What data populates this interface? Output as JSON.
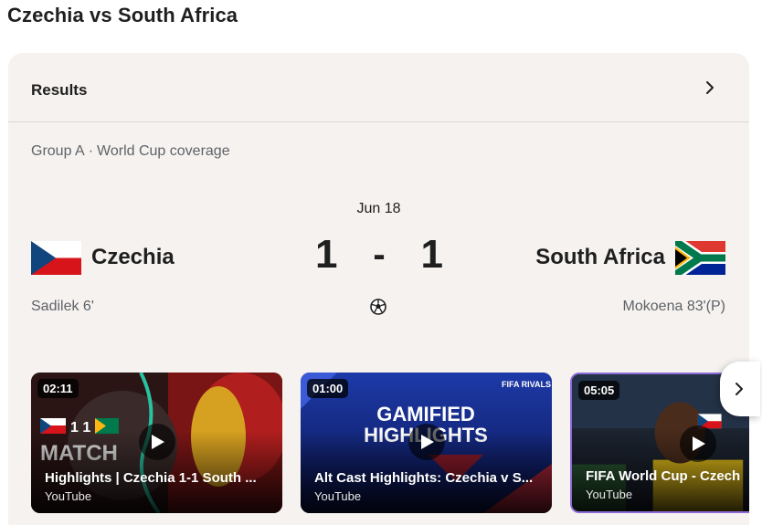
{
  "page": {
    "title": "Czechia vs South Africa"
  },
  "results": {
    "label": "Results"
  },
  "group": {
    "name": "Group A",
    "coverage": "World Cup coverage"
  },
  "match": {
    "date": "Jun 18",
    "home": {
      "name": "Czechia",
      "score": "1",
      "scorer": "Sadilek 6'"
    },
    "away": {
      "name": "South Africa",
      "score": "1",
      "scorer": "Mokoena 83'(P)"
    },
    "score_separator": "-"
  },
  "videos": [
    {
      "duration": "02:11",
      "title": "Highlights | Czechia 1-1 South ...",
      "source": "YouTube",
      "thumb_overlay": "MATCH",
      "thumb_score": "1 1"
    },
    {
      "duration": "01:00",
      "title": "Alt Cast Highlights: Czechia v S...",
      "source": "YouTube",
      "thumb_overlay": "GAMIFIED HIGHLIGHTS",
      "thumb_brand": "FIFA RIVALS"
    },
    {
      "duration": "05:05",
      "title": "FIFA World Cup - Czech",
      "source": "YouTube"
    }
  ],
  "colors": {
    "card_bg": "#f5f2ef",
    "text_primary": "#1f1f1f",
    "text_secondary": "#5f6368",
    "czech_blue": "#11457e",
    "czech_red": "#d7141a",
    "sa_green": "#007a4d",
    "sa_gold": "#ffb612",
    "sa_red": "#de3831",
    "sa_blue": "#002395"
  }
}
